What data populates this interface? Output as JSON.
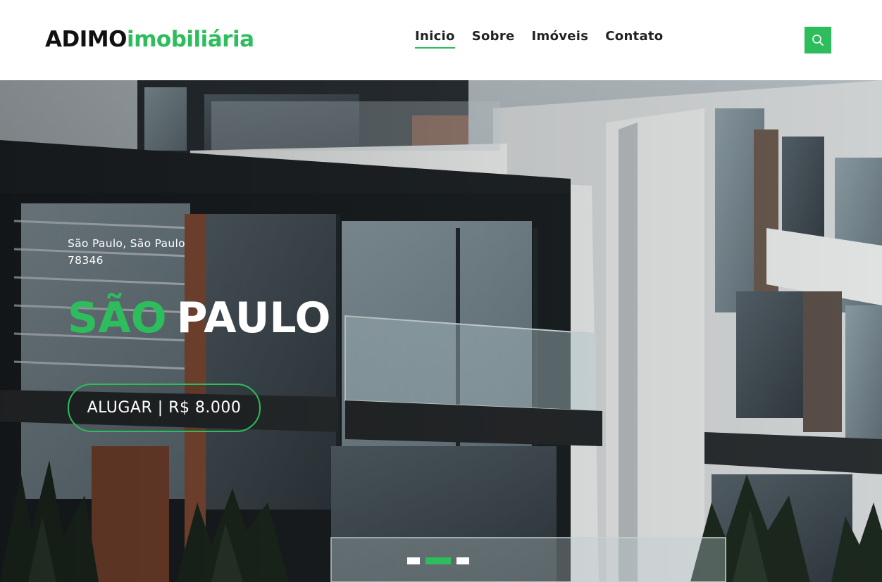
{
  "header": {
    "brand_primary": "ADIMO",
    "brand_secondary": "imobiliária",
    "nav": [
      {
        "label": "Inicio",
        "active": true
      },
      {
        "label": "Sobre",
        "active": false
      },
      {
        "label": "Imóveis",
        "active": false
      },
      {
        "label": "Contato",
        "active": false
      }
    ],
    "search_icon": "search-icon"
  },
  "hero": {
    "location_line1": "São Paulo, São Paulo",
    "location_line2": "78346",
    "title_accent": "SÃO",
    "title_main": "PAULO",
    "cta_label": "ALUGAR | R$ 8.000",
    "slides_total": 3,
    "slide_active": 2,
    "background": "modern-building-photo"
  },
  "colors": {
    "accent": "#2dbd5c",
    "text_dark": "#111111",
    "white": "#ffffff"
  }
}
